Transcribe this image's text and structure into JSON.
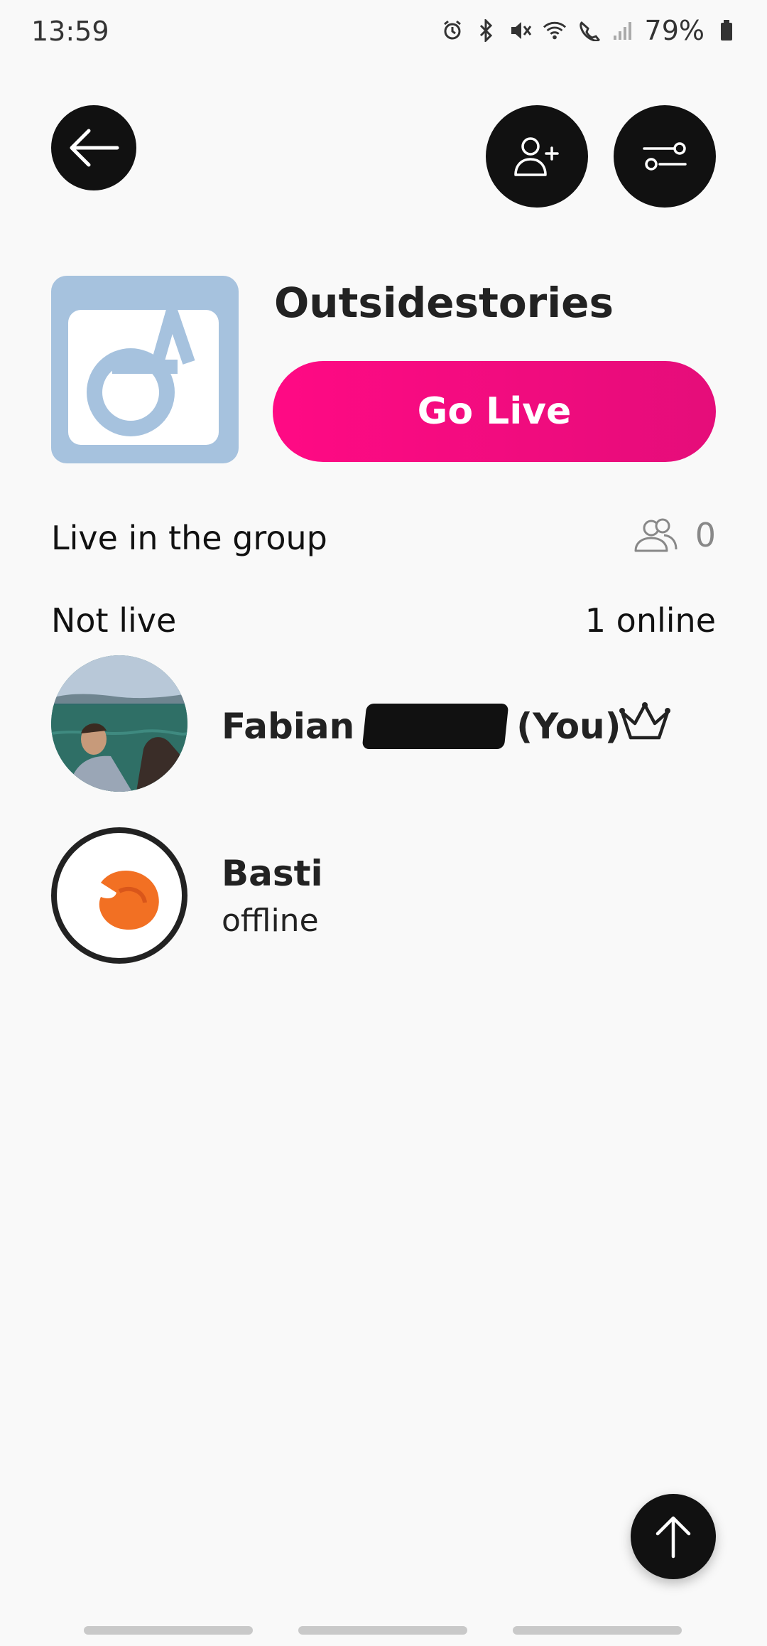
{
  "status_bar": {
    "time": "13:59",
    "battery_percent": "79%",
    "icons": [
      "alarm-icon",
      "bluetooth-icon",
      "mute-icon",
      "wifi-icon",
      "wifi-calling-icon",
      "signal-icon",
      "battery-icon"
    ]
  },
  "header": {
    "back_icon": "arrow-left-icon",
    "add_member_icon": "person-add-icon",
    "settings_icon": "sliders-icon"
  },
  "group": {
    "name": "Outsidestories",
    "logo_bg": "#a6c2de",
    "go_live_label": "Go Live",
    "accent": "#ff0a84"
  },
  "live_section": {
    "label": "Live in the group",
    "count": "0",
    "icon": "people-icon"
  },
  "members_section": {
    "not_live_label": "Not live",
    "online_label": "1 online",
    "members": [
      {
        "first_name": "Fabian",
        "you_tag": "(You)",
        "role_icon": "crown-icon"
      },
      {
        "first_name": "Basti",
        "status": "offline"
      }
    ]
  },
  "fab": {
    "icon": "arrow-up-icon"
  }
}
